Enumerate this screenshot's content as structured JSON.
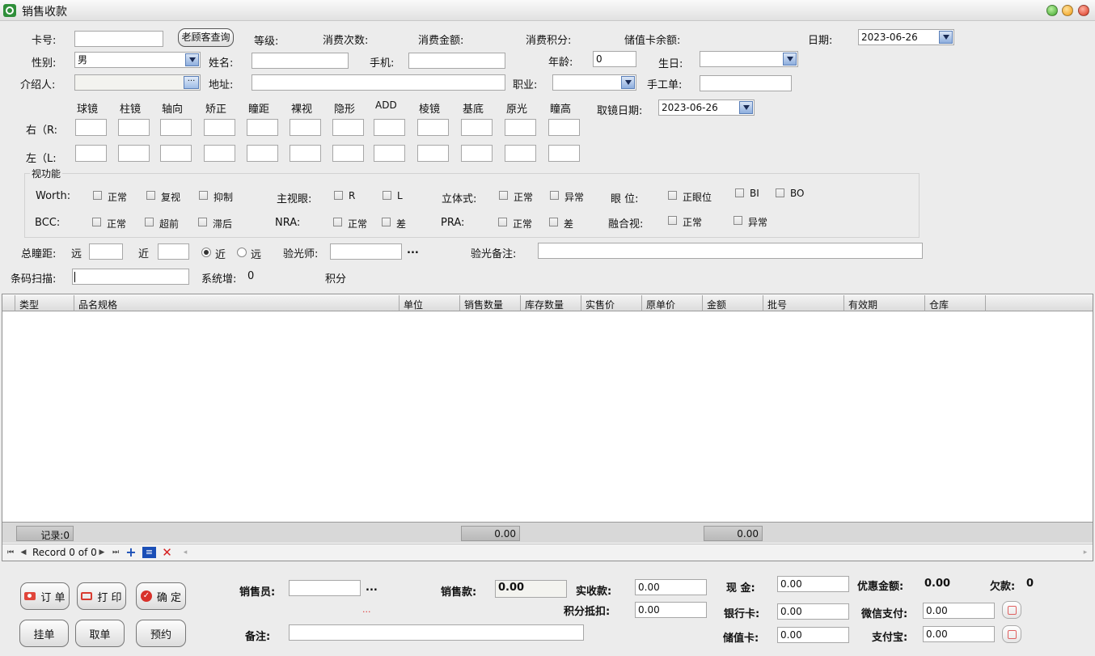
{
  "window": {
    "title": "销售收款"
  },
  "row1": {
    "card_label": "卡号:",
    "card_value": "",
    "old_customer_button": "老顾客查询",
    "level_label": "等级:",
    "count_label": "消费次数:",
    "amount_label": "消费金额:",
    "points_label": "消费积分:",
    "balance_label": "储值卡余额:",
    "date_label": "日期:",
    "date_value": "2023-06-26"
  },
  "row2": {
    "gender_label": "性别:",
    "gender_value": "男",
    "name_label": "姓名:",
    "phone_label": "手机:",
    "age_label": "年龄:",
    "age_value": "0",
    "birthday_label": "生日:"
  },
  "row3": {
    "referrer_label": "介绍人:",
    "address_label": "地址:",
    "job_label": "职业:",
    "manual_label": "手工单:"
  },
  "optometry": {
    "columns": [
      "球镜",
      "柱镜",
      "轴向",
      "矫正",
      "瞳距",
      "裸视",
      "隐形",
      "ADD",
      "棱镜",
      "基底",
      "原光",
      "瞳高"
    ],
    "right_label": "右（R:",
    "left_label": "左（L:",
    "pickup_date_label": "取镜日期:",
    "pickup_date_value": "2023-06-26"
  },
  "vision": {
    "group_title": "视功能",
    "worth_label": "Worth:",
    "worth_options": [
      "正常",
      "复视",
      "抑制"
    ],
    "dominant_label": "主视眼:",
    "dominant_options": [
      "R",
      "L"
    ],
    "stereo_label": "立体式:",
    "stereo_options": [
      "正常",
      "异常"
    ],
    "eyepos_label": "眼  位:",
    "eyepos_options": [
      "正眼位",
      "BI",
      "BO"
    ],
    "bcc_label": "BCC:",
    "bcc_options": [
      "正常",
      "超前",
      "滞后"
    ],
    "nra_label": "NRA:",
    "nra_options": [
      "正常",
      "差"
    ],
    "pra_label": "PRA:",
    "pra_options": [
      "正常",
      "差"
    ],
    "fusion_label": "融合视:",
    "fusion_options": [
      "正常",
      "异常"
    ]
  },
  "pd": {
    "total_label": "总瞳距:",
    "far_label": "远",
    "near_label": "近",
    "radio_near": "近",
    "radio_far": "远",
    "optometrist_label": "验光师:",
    "more": "...",
    "remark_label": "验光备注:"
  },
  "scan": {
    "label": "条码扫描:",
    "system_add": "系统增:",
    "system_add_value": "0",
    "points_label": "积分"
  },
  "grid": {
    "columns": [
      "类型",
      "品名规格",
      "单位",
      "销售数量",
      "库存数量",
      "实售价",
      "原单价",
      "金额",
      "批号",
      "有效期",
      "仓库"
    ],
    "records_label": "记录:0",
    "qty_total": "0.00",
    "amount_total": "0.00",
    "nav_text": "Record 0 of 0"
  },
  "buttons": {
    "order": "订 单",
    "print": "打 印",
    "confirm": "确 定",
    "hold": "挂单",
    "fetch": "取单",
    "reserve": "预约"
  },
  "payment": {
    "salesperson_label": "销售员:",
    "more": "...",
    "red_more": "...",
    "sales_amount_label": "销售款:",
    "sales_amount_value": "0.00",
    "received_label": "实收款:",
    "received_value": "0.00",
    "points_deduct_label": "积分抵扣:",
    "points_deduct_value": "0.00",
    "cash_label": "现  金:",
    "cash_value": "0.00",
    "bank_label": "银行卡:",
    "bank_value": "0.00",
    "stored_label": "储值卡:",
    "stored_value": "0.00",
    "discount_label": "优惠金额:",
    "discount_value": "0.00",
    "debt_label": "欠款:",
    "debt_value": "0",
    "wechat_label": "微信支付:",
    "wechat_value": "0.00",
    "alipay_label": "支付宝:",
    "alipay_value": "0.00",
    "remark_label": "备注:"
  }
}
